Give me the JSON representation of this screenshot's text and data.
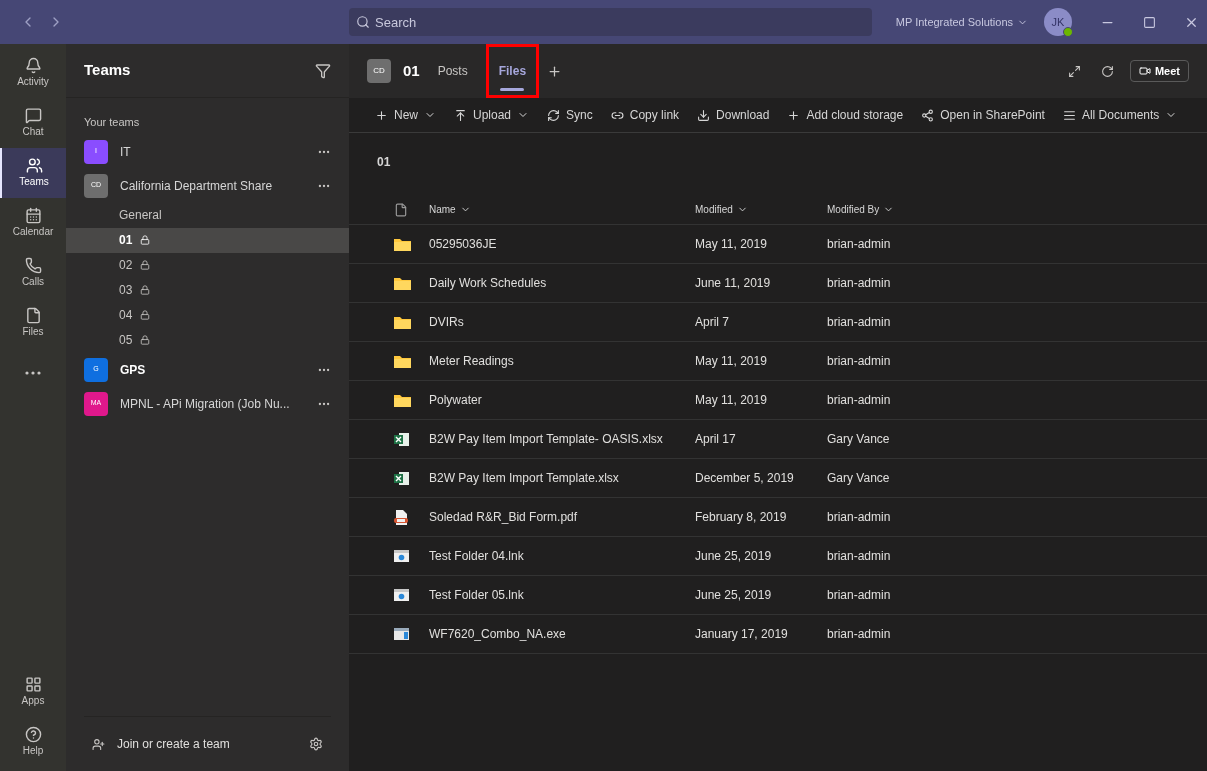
{
  "title_bar": {
    "search": {
      "placeholder": "Search"
    },
    "org": "MP Integrated Solutions",
    "avatar": {
      "initials": "JK",
      "online": true
    }
  },
  "rail": {
    "top": [
      {
        "label": "Activity",
        "kind": "bell",
        "selected": false
      },
      {
        "label": "Chat",
        "kind": "chat",
        "selected": false
      },
      {
        "label": "Teams",
        "kind": "teams",
        "selected": true
      },
      {
        "label": "Calendar",
        "kind": "calendar",
        "selected": false
      },
      {
        "label": "Calls",
        "kind": "phone",
        "selected": false
      },
      {
        "label": "Files",
        "kind": "file",
        "selected": false
      },
      {
        "kind": "more",
        "selected": false
      }
    ],
    "bottom": [
      {
        "label": "Apps",
        "kind": "apps",
        "selected": false
      },
      {
        "label": "Help",
        "kind": "help",
        "selected": false
      }
    ]
  },
  "teams_panel": {
    "title": "Teams",
    "section": "Your teams",
    "join": "Join or create a team",
    "teams": [
      {
        "initials": "I",
        "color": "#8a4dff",
        "name": "IT",
        "unread": false
      },
      {
        "initials": "CD",
        "color": "#6e6e6e",
        "name": "California Department Share",
        "unread": false,
        "channels": [
          {
            "name": "General",
            "private": false,
            "selected": false
          },
          {
            "name": "01",
            "private": true,
            "selected": true
          },
          {
            "name": "02",
            "private": true,
            "selected": false
          },
          {
            "name": "03",
            "private": true,
            "selected": false
          },
          {
            "name": "04",
            "private": true,
            "selected": false
          },
          {
            "name": "05",
            "private": true,
            "selected": false
          }
        ]
      },
      {
        "initials": "G",
        "color": "#0f6fe0",
        "name": "GPS",
        "unread": true
      },
      {
        "initials": "MA",
        "color": "#e0188c",
        "name": "MPNL - APi Migration (Job Nu...",
        "unread": false
      }
    ]
  },
  "channel_header": {
    "avatar": "CD",
    "name": "01",
    "tabs": [
      {
        "label": "Posts",
        "selected": false,
        "highlighted": false
      },
      {
        "label": "Files",
        "selected": true,
        "highlighted": true
      }
    ],
    "meet": "Meet"
  },
  "toolbar": [
    {
      "label": "New",
      "kind": "plus",
      "dropdown": true
    },
    {
      "label": "Upload",
      "kind": "upload",
      "dropdown": true
    },
    {
      "label": "Sync",
      "kind": "sync",
      "dropdown": false
    },
    {
      "label": "Copy link",
      "kind": "link",
      "dropdown": false
    },
    {
      "label": "Download",
      "kind": "download",
      "dropdown": false
    },
    {
      "label": "Add cloud storage",
      "kind": "plus",
      "dropdown": false
    },
    {
      "label": "Open in SharePoint",
      "kind": "sharepoint",
      "dropdown": false
    },
    {
      "label": "All Documents",
      "kind": "list",
      "dropdown": true
    }
  ],
  "folder_title": "01",
  "table": {
    "columns": [
      "Name",
      "Modified",
      "Modified By"
    ],
    "rows": [
      {
        "kind": "folder",
        "name": "05295036JE",
        "modified": "May 11, 2019",
        "by": "brian-admin"
      },
      {
        "kind": "folder",
        "name": "Daily Work Schedules",
        "modified": "June 11, 2019",
        "by": "brian-admin"
      },
      {
        "kind": "folder",
        "name": "DVIRs",
        "modified": "April 7",
        "by": "brian-admin"
      },
      {
        "kind": "folder",
        "name": "Meter Readings",
        "modified": "May 11, 2019",
        "by": "brian-admin"
      },
      {
        "kind": "folder",
        "name": "Polywater",
        "modified": "May 11, 2019",
        "by": "brian-admin"
      },
      {
        "kind": "excel",
        "name": "B2W Pay Item Import Template- OASIS.xlsx",
        "modified": "April 17",
        "by": "Gary Vance"
      },
      {
        "kind": "excel",
        "name": "B2W Pay Item Import Template.xlsx",
        "modified": "December 5, 2019",
        "by": "Gary Vance"
      },
      {
        "kind": "pdf",
        "name": "Soledad R&R_Bid Form.pdf",
        "modified": "February 8, 2019",
        "by": "brian-admin"
      },
      {
        "kind": "link",
        "name": "Test Folder 04.lnk",
        "modified": "June 25, 2019",
        "by": "brian-admin"
      },
      {
        "kind": "link",
        "name": "Test Folder 05.lnk",
        "modified": "June 25, 2019",
        "by": "brian-admin"
      },
      {
        "kind": "exe",
        "name": "WF7620_Combo_NA.exe",
        "modified": "January 17, 2019",
        "by": "brian-admin"
      }
    ]
  }
}
